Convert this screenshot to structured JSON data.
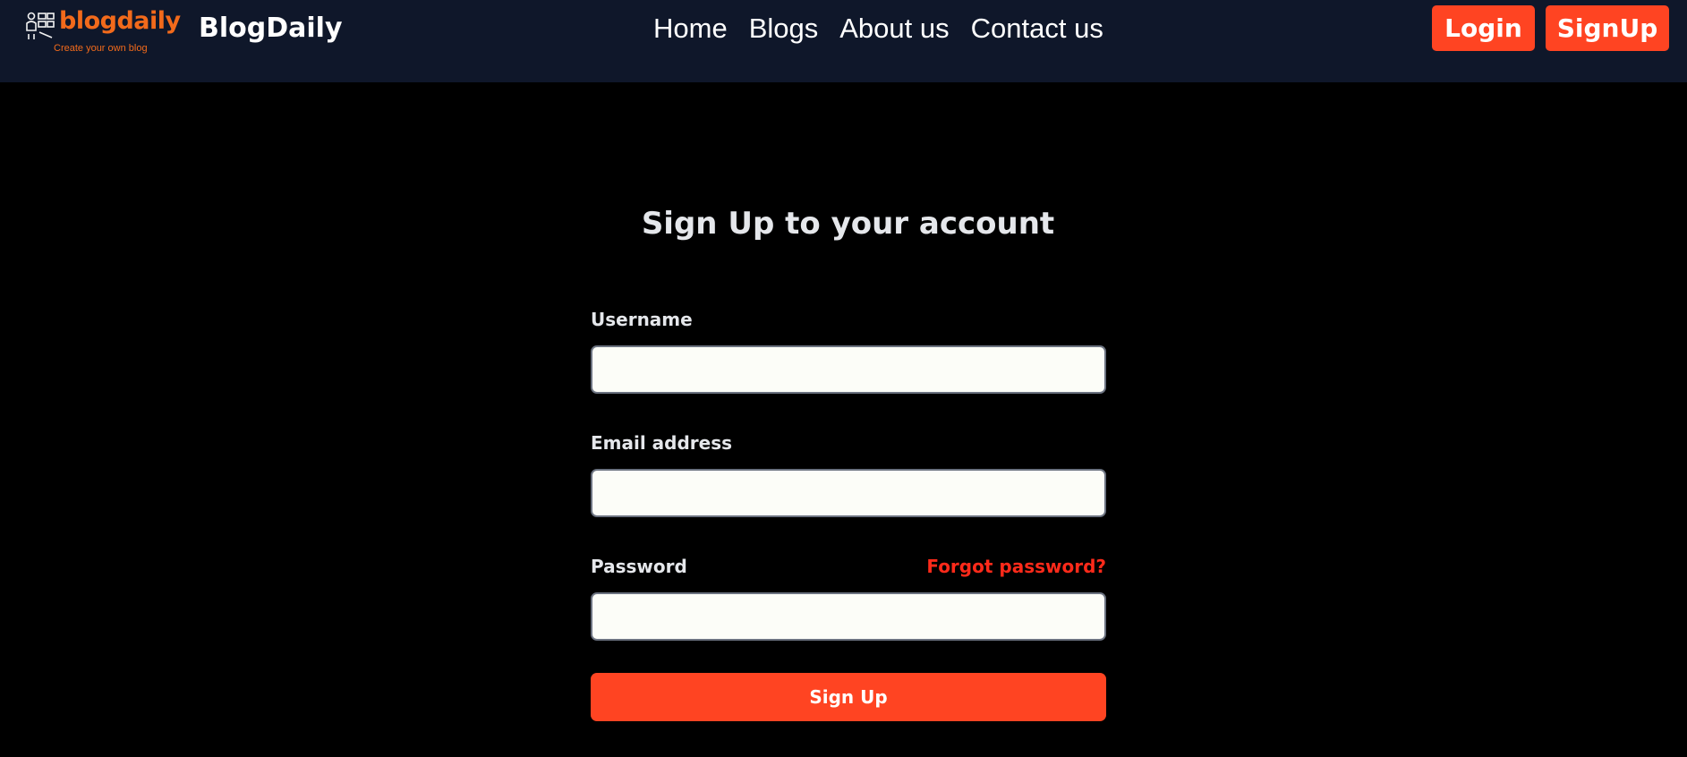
{
  "nav": {
    "logo_word": "blogdaily",
    "logo_tagline": "Create your own blog",
    "brand": "BlogDaily",
    "links": [
      "Home",
      "Blogs",
      "About us",
      "Contact us"
    ],
    "login_label": "Login",
    "signup_label": "SignUp"
  },
  "form": {
    "title": "Sign Up to your account",
    "username_label": "Username",
    "username_value": "",
    "email_label": "Email address",
    "email_value": "",
    "password_label": "Password",
    "password_value": "",
    "forgot_label": "Forgot password?",
    "submit_label": "Sign Up"
  },
  "colors": {
    "navbar_bg": "#0f172a",
    "page_bg": "#000000",
    "accent": "#ff4422",
    "logo_orange": "#f26a1b",
    "forgot_red": "#ff2a1a"
  },
  "icons": {
    "logo_icon": "blog-tools-icon"
  }
}
